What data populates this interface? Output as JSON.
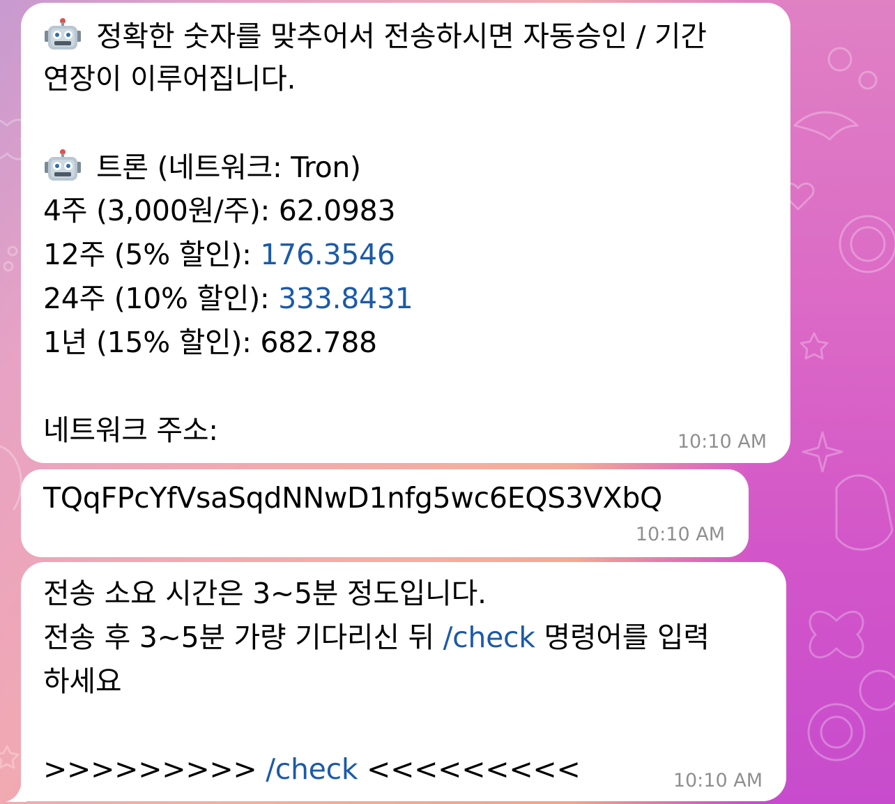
{
  "messages": [
    {
      "robot_icon": "robot-face-icon",
      "line1": "정확한 숫자를 맞추어서 전송하시면 자동승인 / 기간",
      "line2": "연장이 이루어집니다.",
      "line3": "트론 (네트워크: Tron)",
      "line4": "4주 (3,000원/주): 62.0983",
      "line5_prefix": "12주 (5% 할인): ",
      "line5_value": "176.3546",
      "line6_prefix": "24주 (10% 할인): ",
      "line6_value": "333.8431",
      "line7": "1년 (15% 할인): 682.788",
      "line8": "네트워크 주소:",
      "time": "10:10 AM"
    },
    {
      "address": "TQqFPcYfVsaSqdNNwD1nfg5wc6EQS3VXbQ",
      "time": "10:10 AM"
    },
    {
      "line1": "전송 소요 시간은 3~5분 정도입니다.",
      "line2_prefix": "전송 후 3~5분 가량 기다리신 뒤 ",
      "line2_link": "/check",
      "line2_suffix": " 명령어를 입력",
      "line3": "하세요",
      "line4_prefix": ">>>>>>>>> ",
      "line4_link": "/check",
      "line4_suffix": " <<<<<<<<<",
      "time": "10:10 AM"
    }
  ],
  "colors": {
    "link": "#1b5aa8",
    "timestamp": "#8f8f8f",
    "bubble": "#ffffff"
  }
}
